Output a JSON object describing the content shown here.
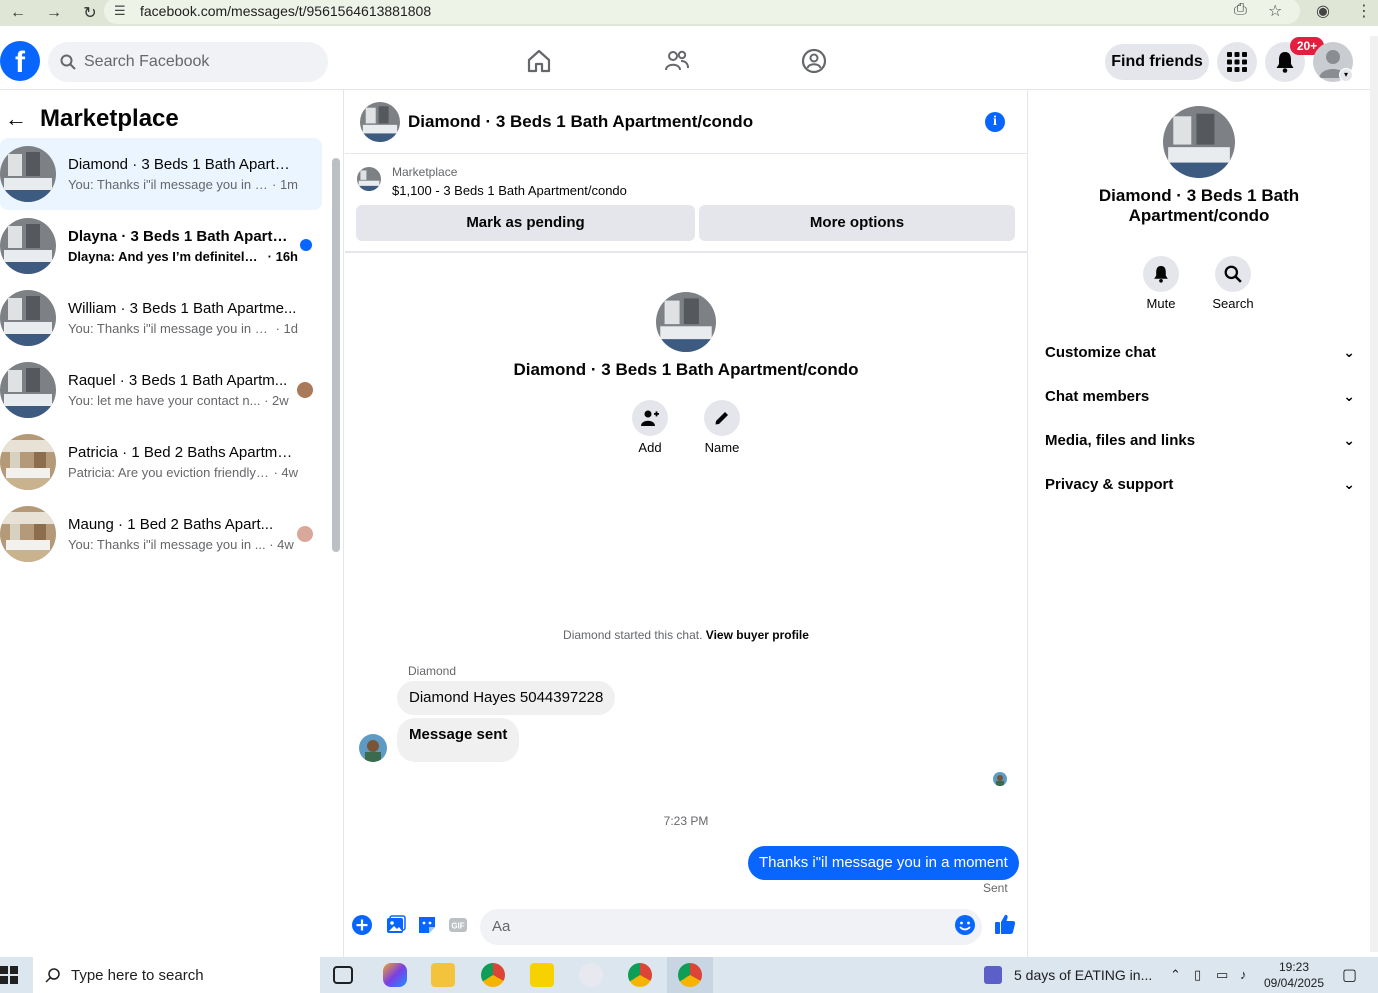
{
  "browser": {
    "url": "facebook.com/messages/t/9561564613881808"
  },
  "header": {
    "search_placeholder": "Search Facebook",
    "find_friends": "Find friends",
    "notifications_badge": "20+"
  },
  "sidebar": {
    "title": "Marketplace",
    "conversations": [
      {
        "title": "Diamond · 3 Beds 1 Bath Apartm...",
        "snippet": "You: Thanks i\"il message you in a ...",
        "time": "· 1m",
        "active": true,
        "unread": false
      },
      {
        "title": "Dlayna · 3 Beds 1 Bath Apartm...",
        "snippet": "Dlayna: And yes I’m definitely i...",
        "time": "· 16h",
        "active": false,
        "unread": true
      },
      {
        "title": "William · 3 Beds 1 Bath Apartme...",
        "snippet": "You: Thanks i\"il message you in a ...",
        "time": "· 1d",
        "active": false,
        "unread": false
      },
      {
        "title": "Raquel · 3 Beds 1 Bath Apartm...",
        "snippet": "You: let me have your contact n...",
        "time": "· 2w",
        "active": false,
        "unread": false
      },
      {
        "title": "Patricia · 1 Bed 2 Baths Apartme...",
        "snippet": "Patricia: Are you eviction friendly? ...",
        "time": "· 4w",
        "active": false,
        "unread": false
      },
      {
        "title": "Maung · 1 Bed 2 Baths Apart...",
        "snippet": "You: Thanks i\"il message you in ...",
        "time": "· 4w",
        "active": false,
        "unread": false
      }
    ]
  },
  "chat": {
    "title": "Diamond · 3 Beds 1 Bath Apartment/condo",
    "marketplace_label": "Marketplace",
    "listing": "$1,100 - 3 Beds 1 Bath Apartment/condo",
    "mark_pending": "Mark as pending",
    "more_options": "More options",
    "intro_title": "Diamond · 3 Beds 1 Bath Apartment/condo",
    "add_label": "Add",
    "name_label": "Name",
    "started_text": "Diamond started this chat.",
    "view_buyer_profile": "View buyer profile",
    "sender_name": "Diamond",
    "messages_in": [
      "Diamond Hayes 5044397228",
      "Message sent"
    ],
    "timestamp": "7:23 PM",
    "message_out": "Thanks i\"il message you in a moment",
    "sent_status": "Sent",
    "composer_placeholder": "Aa"
  },
  "details": {
    "title": "Diamond · 3 Beds 1 Bath Apartment/condo",
    "mute_label": "Mute",
    "search_label": "Search",
    "sections": [
      "Customize chat",
      "Chat members",
      "Media, files and links",
      "Privacy & support"
    ]
  },
  "taskbar": {
    "search_placeholder": "Type here to search",
    "media_title": "5 days of EATING in...",
    "time": "19:23",
    "date": "09/04/2025"
  },
  "colors": {
    "accent": "#0866ff",
    "badge": "#e41e3f",
    "active_row": "#ebf5ff",
    "bubble_in": "#f0f0f0"
  }
}
